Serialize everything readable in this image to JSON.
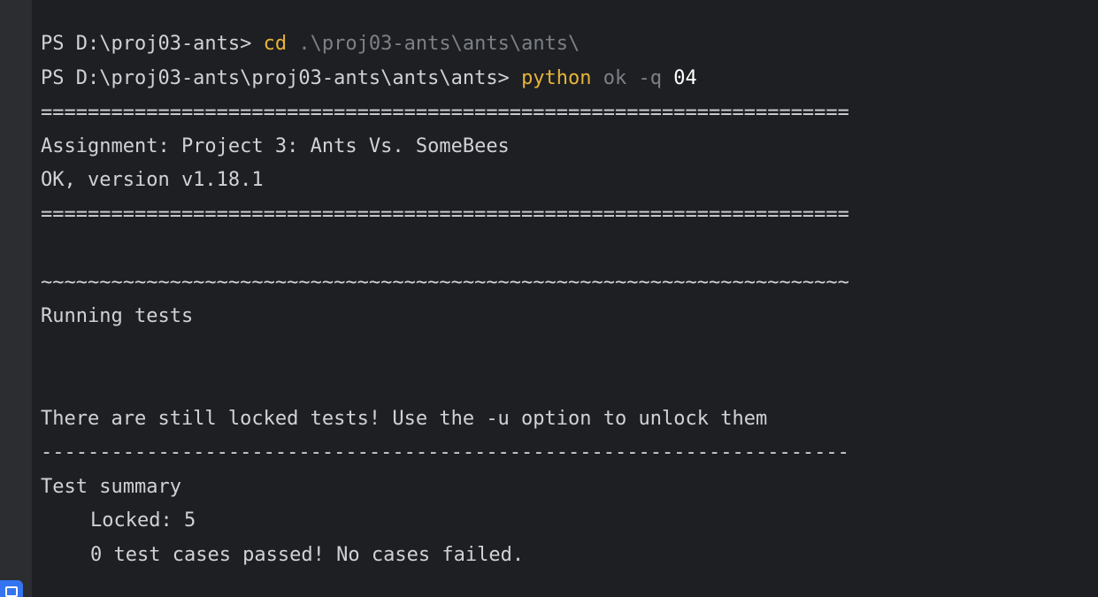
{
  "terminal": {
    "line1": {
      "prompt": "PS D:\\proj03-ants> ",
      "command": "cd",
      "argument": " .\\proj03-ants\\ants\\ants\\"
    },
    "line2": {
      "prompt": "PS D:\\proj03-ants\\proj03-ants\\ants\\ants> ",
      "command": "python",
      "flags": " ok -q",
      "argument": " 04"
    },
    "separator_top": "=====================================================================",
    "assignment": "Assignment: Project 3: Ants Vs. SomeBees",
    "version": "OK, version v1.18.1",
    "separator_bottom": "=====================================================================",
    "tilde_line": "~~~~~~~~~~~~~~~~~~~~~~~~~~~~~~~~~~~~~~~~~~~~~~~~~~~~~~~~~~~~~~~~~~~~~",
    "running": "Running tests",
    "locked_message": "There are still locked tests! Use the -u option to unlock them",
    "dash_line": "---------------------------------------------------------------------",
    "summary_title": "Test summary",
    "locked_count": "Locked: 5",
    "result": "0 test cases passed! No cases failed."
  },
  "colors": {
    "background": "#1e1f22",
    "gutter": "#2b2d30",
    "text": "#cfd2d6",
    "keyword": "#e5b43a",
    "dim": "#7c8087",
    "accent": "#3574f0"
  },
  "icons": {
    "gutter_button": "terminal-icon"
  }
}
